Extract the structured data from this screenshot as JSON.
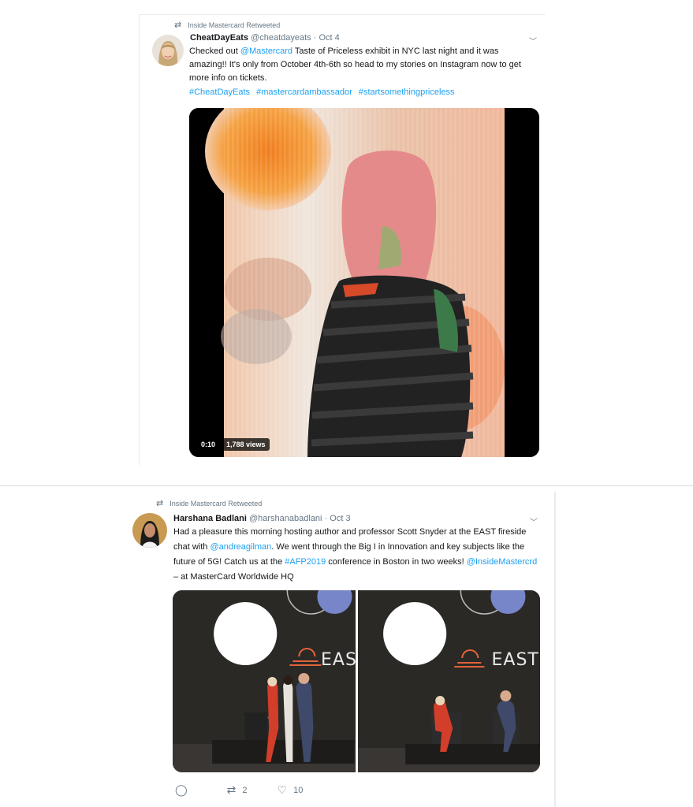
{
  "tweet1": {
    "retweet_label": "Inside Mastercard Retweeted",
    "name": "CheatDayEats",
    "handle": "@cheatdayeats",
    "separator": " · ",
    "date": "Oct 4",
    "text_1": "Checked out ",
    "mention": "@Mastercard",
    "text_2": " Taste of Priceless exhibit in NYC last night and it was amazing!!  It's only from October 4th-6th so head to my stories on Instagram now to get more info on tickets.",
    "hashtags": [
      "#CheatDayEats",
      "#mastercardambassador",
      "#startsomethingpriceless"
    ],
    "video_time": "0:10",
    "video_views": "1,788 views"
  },
  "tweet2": {
    "retweet_label": "Inside Mastercard Retweeted",
    "name": "Harshana Badlani",
    "handle": "@harshanabadlani",
    "separator": " · ",
    "date": "Oct 3",
    "text_1": "Had a pleasure this morning hosting author and professor Scott Snyder at the EAST fireside chat with ",
    "mention_1": "@andreagilman",
    "text_2": ". We went through the Big I  in Innovation and key subjects like the future of 5G! Catch us at the ",
    "hashtag": "#AFP2019",
    "text_3": " conference in Boston in two weeks! ",
    "mention_2": "@InsideMastercrd",
    "text_4": " – at MasterCard Worldwide HQ",
    "photo_text": "EAST",
    "retweets": "2",
    "likes": "10"
  },
  "icons": {
    "retweet": "retweet-icon",
    "chevron": "chevron-down-icon",
    "reply": "reply-icon",
    "like": "heart-icon"
  },
  "colors": {
    "link": "#1da1f2",
    "muted": "#657786",
    "text": "#14171a"
  }
}
